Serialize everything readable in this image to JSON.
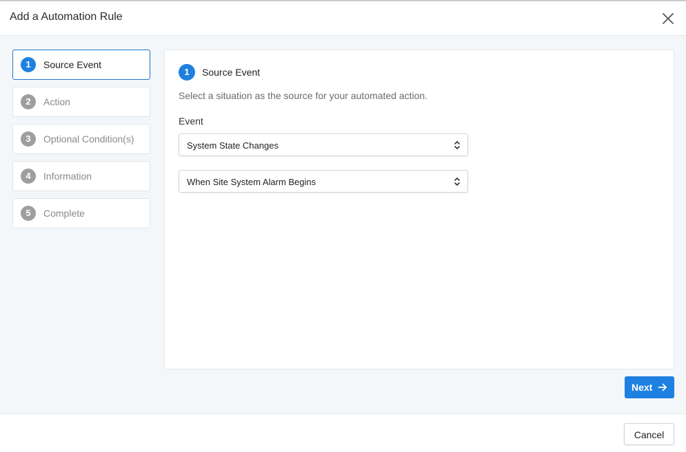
{
  "dialog": {
    "title": "Add a Automation Rule",
    "close_icon": "close-icon"
  },
  "steps": [
    {
      "number": "1",
      "label": "Source Event",
      "state": "active"
    },
    {
      "number": "2",
      "label": "Action",
      "state": "inactive"
    },
    {
      "number": "3",
      "label": "Optional Condition(s)",
      "state": "inactive"
    },
    {
      "number": "4",
      "label": "Information",
      "state": "inactive"
    },
    {
      "number": "5",
      "label": "Complete",
      "state": "inactive"
    }
  ],
  "panel": {
    "number": "1",
    "heading": "Source Event",
    "description": "Select a situation as the source for your automated action.",
    "event_label": "Event",
    "event_type_select": {
      "value": "System State Changes",
      "icon": "chevron-updown-icon"
    },
    "event_trigger_select": {
      "value": "When Site System Alarm Begins",
      "icon": "chevron-updown-icon"
    }
  },
  "buttons": {
    "next_label": "Next",
    "next_icon": "arrow-right-icon",
    "cancel_label": "Cancel"
  },
  "colors": {
    "accent": "#1e80e0",
    "active_border": "#1e73c6",
    "inactive_step": "#9e9e9e",
    "body_bg": "#f4f7fa"
  }
}
